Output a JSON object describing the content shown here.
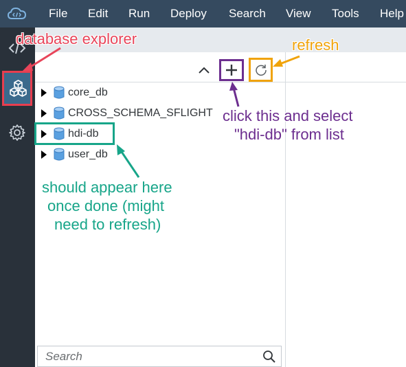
{
  "menu": {
    "items": [
      "File",
      "Edit",
      "Run",
      "Deploy",
      "Search",
      "View",
      "Tools",
      "Help"
    ]
  },
  "explorer": {
    "tree": [
      {
        "label": "core_db"
      },
      {
        "label": "CROSS_SCHEMA_SFLIGHT"
      },
      {
        "label": "hdi-db"
      },
      {
        "label": "user_db"
      }
    ]
  },
  "search": {
    "placeholder": "Search"
  },
  "annotations": {
    "database_explorer": "database explorer",
    "refresh": "refresh",
    "click_line1": "click this and select",
    "click_line2": "\"hdi-db\" from list",
    "appear_line1": "should appear here",
    "appear_line2": "once done (might",
    "appear_line3": "need to refresh)"
  },
  "colors": {
    "menubar": "#354a5f",
    "rail": "#29313a",
    "annotation_red": "#e8455a",
    "annotation_orange": "#f0a30a",
    "annotation_purple": "#6c2e8f",
    "annotation_teal": "#17a589"
  },
  "icons": {
    "app_logo": "cloud-code-icon",
    "rail_top": "code-icon",
    "rail_active": "database-cubes-icon",
    "rail_settings": "gear-icon",
    "add": "plus-icon",
    "refresh": "refresh-icon",
    "search": "search-icon"
  }
}
